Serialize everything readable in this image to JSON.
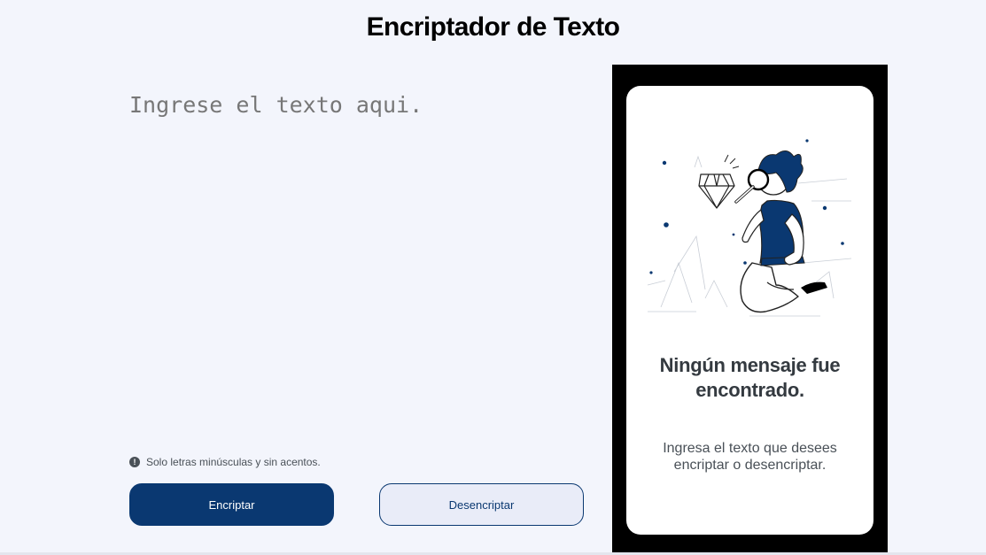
{
  "header": {
    "title": "Encriptador de Texto"
  },
  "editor": {
    "placeholder": "Ingrese el texto aqui.",
    "value": ""
  },
  "hint": {
    "icon": "info-icon",
    "icon_glyph": "!",
    "text": "Solo letras minúsculas y sin acentos."
  },
  "actions": {
    "encrypt_label": "Encriptar",
    "decrypt_label": "Desencriptar"
  },
  "result_panel": {
    "illustration": "person-with-magnifier-illustration",
    "title": "Ningún mensaje fue encontrado.",
    "message": "Ingresa el texto que desees encriptar o desencriptar."
  },
  "colors": {
    "background": "#f3f5fc",
    "primary": "#0a3871",
    "secondary": "#e9ecf8",
    "panel_frame": "#000000",
    "card": "#ffffff"
  }
}
